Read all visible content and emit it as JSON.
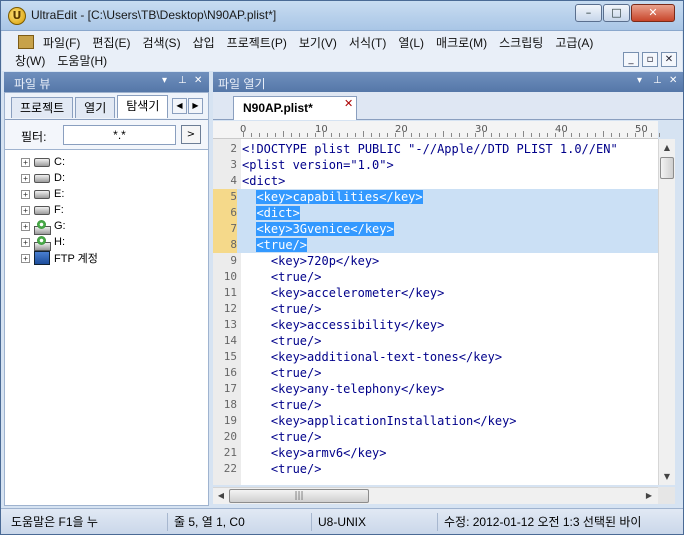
{
  "window": {
    "title": "UltraEdit - [C:\\Users\\TB\\Desktop\\N90AP.plist*]",
    "min_label": "–",
    "max_label": "□",
    "close_label": "✕"
  },
  "menu": {
    "row1": [
      "파일(F)",
      "편집(E)",
      "검색(S)",
      "삽입",
      "프로젝트(P)",
      "보기(V)",
      "서식(T)",
      "열(L)",
      "매크로(M)",
      "스크립팅",
      "고급(A)"
    ],
    "row2": [
      "창(W)",
      "도움말(H)"
    ]
  },
  "left_panel": {
    "title": "파일 뷰",
    "tabs": [
      "프로젝트",
      "열기",
      "탐색기"
    ],
    "active_tab": "탐색기",
    "filter_label": "필터:",
    "filter_value": "*.*",
    "filter_button": ">",
    "tree": [
      {
        "label": "C:",
        "icon": "hard-drive-icon"
      },
      {
        "label": "D:",
        "icon": "hard-drive-icon"
      },
      {
        "label": "E:",
        "icon": "hard-drive-icon"
      },
      {
        "label": "F:",
        "icon": "hard-drive-icon"
      },
      {
        "label": "G:",
        "icon": "dvd-drive-icon"
      },
      {
        "label": "H:",
        "icon": "dvd-drive-icon"
      },
      {
        "label": "FTP 계정",
        "icon": "ftp-icon"
      }
    ]
  },
  "editor": {
    "panel_title": "파일 열기",
    "tab_label": "N90AP.plist*",
    "ruler_labels": [
      "0",
      "10",
      "20",
      "30",
      "40",
      "50"
    ],
    "lines": [
      {
        "n": "2",
        "text": "<!DOCTYPE plist PUBLIC \"-//Apple//DTD PLIST 1.0//EN\"",
        "selected": false
      },
      {
        "n": "3",
        "text": "<plist version=\"1.0\">",
        "selected": false
      },
      {
        "n": "4",
        "text": "<dict>",
        "selected": false
      },
      {
        "n": "5",
        "text": "  <key>capabilities</key>",
        "selected": true
      },
      {
        "n": "6",
        "text": "  <dict>",
        "selected": true
      },
      {
        "n": "7",
        "text": "  <key>3Gvenice</key>",
        "selected": true
      },
      {
        "n": "8",
        "text": "  <true/>",
        "selected": true
      },
      {
        "n": "9",
        "text": "    <key>720p</key>",
        "selected": false
      },
      {
        "n": "10",
        "text": "    <true/>",
        "selected": false
      },
      {
        "n": "11",
        "text": "    <key>accelerometer</key>",
        "selected": false
      },
      {
        "n": "12",
        "text": "    <true/>",
        "selected": false
      },
      {
        "n": "13",
        "text": "    <key>accessibility</key>",
        "selected": false
      },
      {
        "n": "14",
        "text": "    <true/>",
        "selected": false
      },
      {
        "n": "15",
        "text": "    <key>additional-text-tones</key>",
        "selected": false
      },
      {
        "n": "16",
        "text": "    <true/>",
        "selected": false
      },
      {
        "n": "17",
        "text": "    <key>any-telephony</key>",
        "selected": false
      },
      {
        "n": "18",
        "text": "    <true/>",
        "selected": false
      },
      {
        "n": "19",
        "text": "    <key>applicationInstallation</key>",
        "selected": false
      },
      {
        "n": "20",
        "text": "    <true/>",
        "selected": false
      },
      {
        "n": "21",
        "text": "    <key>armv6</key>",
        "selected": false
      },
      {
        "n": "22",
        "text": "    <true/>",
        "selected": false
      }
    ]
  },
  "statusbar": {
    "help": "도움말은 F1을 누",
    "position": "줄 5, 열 1, C0",
    "encoding": "U8-UNIX",
    "modified": "수정: 2012-01-12 오전 1:3",
    "selection": "선택된 바이"
  },
  "colors": {
    "selection": "#3399ff",
    "selected_row": "#cbe0f5",
    "code_text": "#00008a",
    "panel_header": "#5577a8"
  }
}
